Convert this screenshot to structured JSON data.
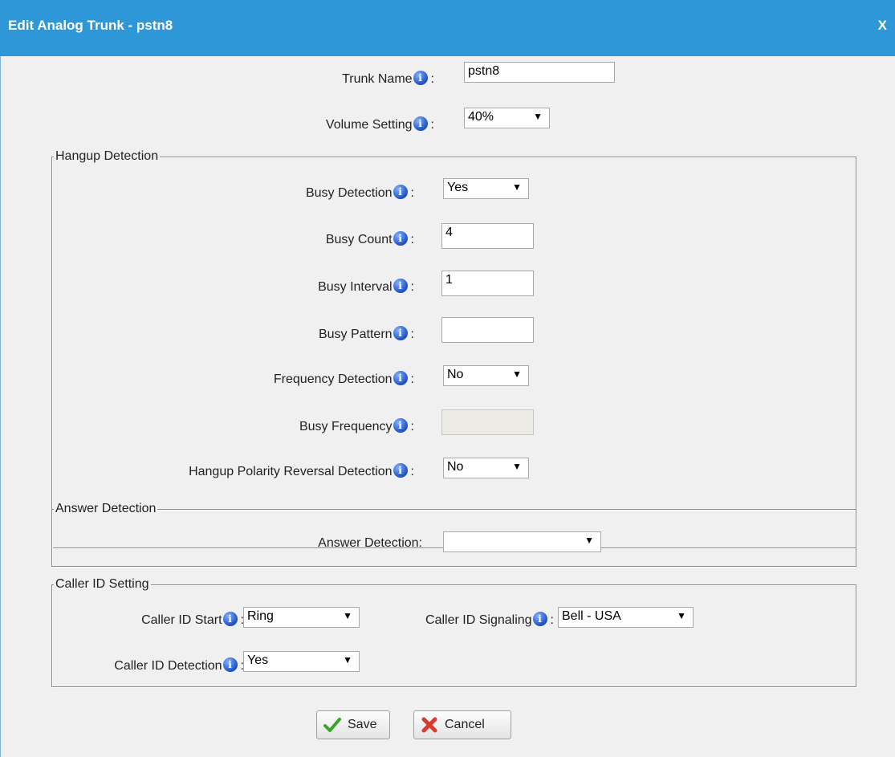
{
  "dialog": {
    "title": "Edit Analog Trunk - pstn8",
    "close_label": "X"
  },
  "fields": {
    "trunk_name": {
      "label": "Trunk Name",
      "value": "pstn8"
    },
    "volume_setting": {
      "label": "Volume Setting",
      "value": "40%"
    }
  },
  "hangup": {
    "legend": "Hangup Detection",
    "busy_detection": {
      "label": "Busy Detection",
      "value": "Yes"
    },
    "busy_count": {
      "label": "Busy Count",
      "value": "4"
    },
    "busy_interval": {
      "label": "Busy Interval",
      "value": "1"
    },
    "busy_pattern": {
      "label": "Busy Pattern",
      "value": ""
    },
    "frequency_detection": {
      "label": "Frequency Detection",
      "value": "No"
    },
    "busy_frequency": {
      "label": "Busy Frequency",
      "value": ""
    },
    "polarity_reversal": {
      "label": "Hangup Polarity Reversal Detection",
      "value": "No"
    }
  },
  "answer": {
    "legend": "Answer Detection",
    "answer_detection": {
      "label": "Answer Detection:",
      "value": ""
    }
  },
  "callerid": {
    "legend": "Caller ID Setting",
    "start": {
      "label": "Caller ID Start",
      "value": "Ring"
    },
    "signaling": {
      "label": "Caller ID Signaling",
      "value": "Bell - USA"
    },
    "detection": {
      "label": "Caller ID Detection",
      "value": "Yes"
    }
  },
  "buttons": {
    "save": "Save",
    "cancel": "Cancel"
  },
  "colors": {
    "title_bar": "#2e97d8",
    "info_icon": "#1e4fc2"
  }
}
